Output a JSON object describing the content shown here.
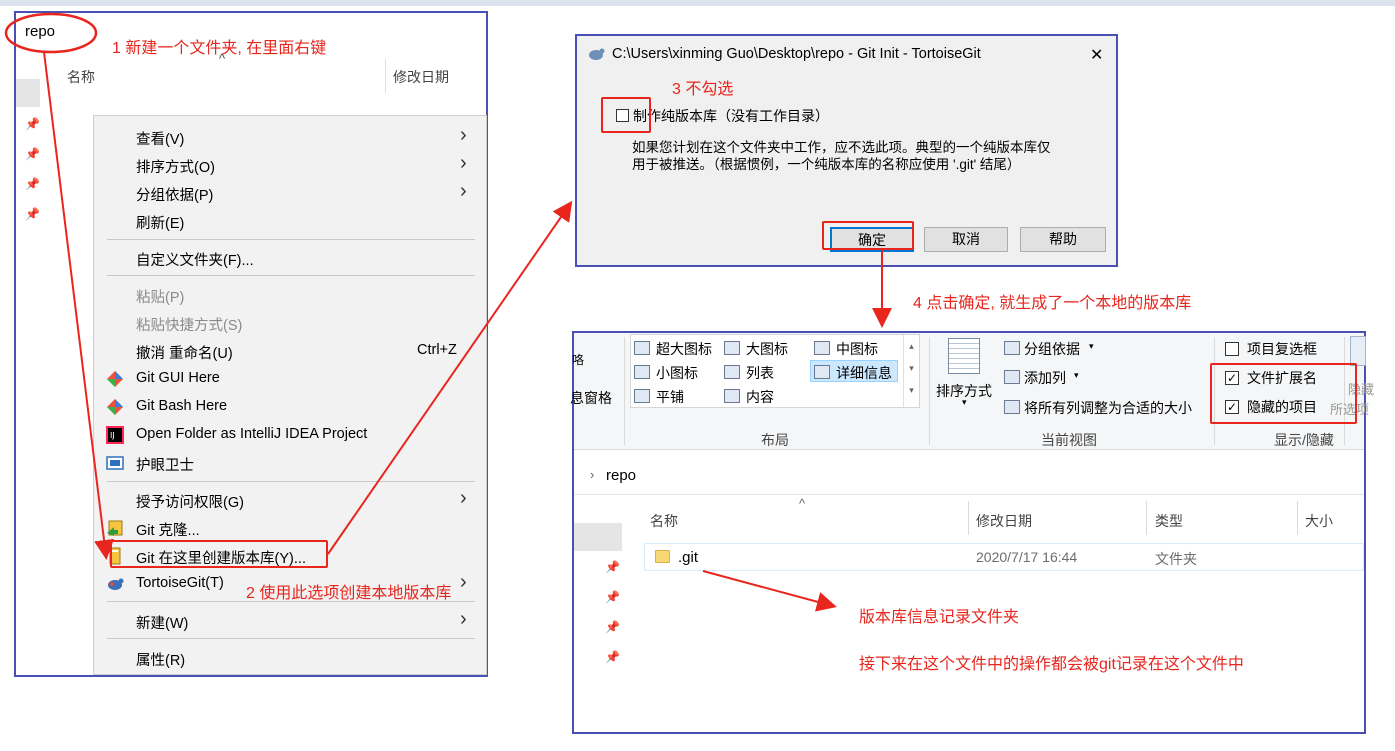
{
  "colors": {
    "annotation_red": "#e8261e",
    "frame_blue": "#4a4fb4",
    "menu_bg": "#f2f2f2",
    "dialog_bg": "#f0f0f0"
  },
  "annotations": {
    "step1": "1 新建一个文件夹, 在里面右键",
    "step2": "2 使用此选项创建本地版本库",
    "step3": "3 不勾选",
    "step4": "4 点击确定, 就生成了一个本地的版本库",
    "note1": "版本库信息记录文件夹",
    "note2": "接下来在这个文件中的操作都会被git记录在这个文件中"
  },
  "left_explorer": {
    "folder_name": "repo",
    "col_name": "名称",
    "col_date": "修改日期",
    "sort_indicator": "^",
    "context_menu": [
      {
        "label": "查看(V)",
        "submenu": true
      },
      {
        "label": "排序方式(O)",
        "submenu": true
      },
      {
        "label": "分组依据(P)",
        "submenu": true
      },
      {
        "label": "刷新(E)"
      },
      {
        "label": "自定义文件夹(F)..."
      },
      {
        "label": "粘贴(P)",
        "disabled": true
      },
      {
        "label": "粘贴快捷方式(S)",
        "disabled": true
      },
      {
        "label": "撤消 重命名(U)",
        "shortcut": "Ctrl+Z"
      },
      {
        "label": "Git GUI Here",
        "icon": "git-icon"
      },
      {
        "label": "Git Bash Here",
        "icon": "git-icon"
      },
      {
        "label": "Open Folder as IntelliJ IDEA Project",
        "icon": "intellij-icon"
      },
      {
        "label": "护眼卫士",
        "icon": "eye-guard-icon"
      },
      {
        "label": "授予访问权限(G)",
        "submenu": true
      },
      {
        "label": "Git 克隆...",
        "icon": "tortoisegit-clone-icon"
      },
      {
        "label": "Git 在这里创建版本库(Y)...",
        "icon": "tortoisegit-repo-icon"
      },
      {
        "label": "TortoiseGit(T)",
        "icon": "tortoisegit-icon",
        "submenu": true
      },
      {
        "label": "新建(W)",
        "submenu": true
      },
      {
        "label": "属性(R)"
      }
    ]
  },
  "dialog": {
    "title": "C:\\Users\\xinming Guo\\Desktop\\repo - Git Init - TortoiseGit",
    "close": "✕",
    "checkbox_label": "制作纯版本库（没有工作目录）",
    "checkbox_checked": false,
    "description_line1": "如果您计划在这个文件夹中工作，应不选此项。典型的一个纯版本库仅",
    "description_line2": "用于被推送。（根据惯例，一个纯版本库的名称应使用 '.git' 结尾）",
    "ok": "确定",
    "cancel": "取消",
    "help": "帮助"
  },
  "right_explorer": {
    "ribbon": {
      "left_cut_top": "咯",
      "left_cut_bottom": "息窗格",
      "layout_items": [
        "超大图标",
        "大图标",
        "中图标",
        "小图标",
        "列表",
        "详细信息",
        "平铺",
        "内容"
      ],
      "layout_selected": "详细信息",
      "group_layout": "布局",
      "sort_by": "排序方式",
      "group_by": "分组依据",
      "add_column": "添加列",
      "fit_columns": "将所有列调整为合适的大小",
      "group_current_view": "当前视图",
      "item_checkbox": "项目复选框",
      "item_checkbox_checked": false,
      "file_ext": "文件扩展名",
      "file_ext_checked": true,
      "hidden_items": "隐藏的项目",
      "hidden_items_checked": true,
      "group_show_hide": "显示/隐藏",
      "cut_hide": "隐藏",
      "cut_selected": "所选项"
    },
    "breadcrumb": "repo",
    "columns": {
      "name": "名称",
      "date": "修改日期",
      "type": "类型",
      "size": "大小"
    },
    "files": [
      {
        "name": ".git",
        "date": "2020/7/17 16:44",
        "type": "文件夹"
      }
    ]
  }
}
